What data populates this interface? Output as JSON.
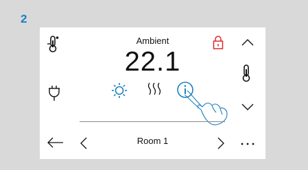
{
  "step_number": "2",
  "screen": {
    "label": "Ambient",
    "temperature": "22.1",
    "room_name": "Room 1"
  },
  "icons": {
    "thermostat_setting": "thermometer-gear-icon",
    "plug": "plug-icon",
    "lock": "lock-icon",
    "arrow_up": "chevron-up-icon",
    "arrow_down": "chevron-down-icon",
    "thermometer": "thermometer-icon",
    "sun": "sun-icon",
    "heat": "heat-waves-icon",
    "info": "info-icon",
    "back": "arrow-left-icon",
    "prev": "chevron-left-icon",
    "next": "chevron-right-icon",
    "more": "more-dots-icon",
    "hand": "hand-pointer-icon"
  },
  "colors": {
    "accent": "#1a7fc0",
    "lock_red": "#e0262b",
    "text": "#111111",
    "background": "#d9d9d9"
  }
}
